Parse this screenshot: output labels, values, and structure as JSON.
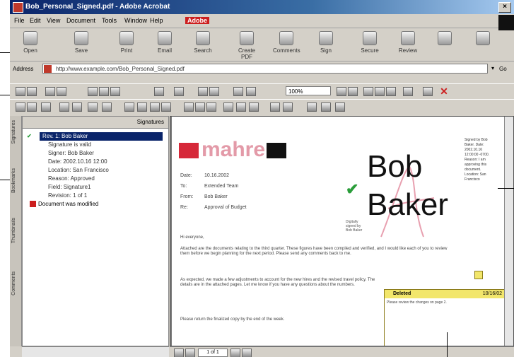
{
  "window": {
    "title": "Bob_Personal_Signed.pdf - Adobe Acrobat"
  },
  "menu": [
    "File",
    "Edit",
    "View",
    "Document",
    "Tools",
    "Window",
    "Help"
  ],
  "menu_badge": "Adobe",
  "toolbar": [
    "Open",
    "Save",
    "Print",
    "Email",
    "Search",
    "Create PDF",
    "Comments",
    "Sign",
    "Secure",
    "Review"
  ],
  "address": {
    "label": "Address",
    "value": "http://www.example.com/Bob_Personal_Signed.pdf",
    "go_label": "Go"
  },
  "zoom": "100%",
  "nav_tabs": [
    "Signatures",
    "Bookmarks",
    "Thumbnails",
    "Comments"
  ],
  "signatures_panel": {
    "header": "Signatures",
    "selected": "Rev. 1: Bob Baker",
    "children": [
      "Signature is valid",
      "Signer: Bob Baker",
      "Date: 2002.10.16 12:00",
      "Location: San Francisco",
      "Reason: Approved",
      "Field: Signature1",
      "Revision: 1 of 1"
    ],
    "warning": "Document was modified"
  },
  "document": {
    "logo_text": "mahre",
    "memo": [
      {
        "k": "Date:",
        "v": "10.16.2002"
      },
      {
        "k": "To:",
        "v": "Extended Team"
      },
      {
        "k": "From:",
        "v": "Bob Baker"
      },
      {
        "k": "Re:",
        "v": "Approval of Budget"
      }
    ],
    "signer_name_1": "Bob",
    "signer_name_2": "Baker",
    "sig_caption": "Digitally signed by Bob Baker",
    "side_text": "Signed by Bob Baker. Date: 2002.10.16 12:00:00 -0700. Reason: I am approving this document. Location: San Francisco",
    "greeting": "Hi everyone,",
    "para1": "Attached are the documents relating to the third quarter. These figures have been compiled and verified, and I would like each of you to review them before we begin planning for the next period. Please send any comments back to me.",
    "para2": "As expected, we made a few adjustments to account for the new hires and the revised travel policy. The details are in the attached pages. Let me know if you have any questions about the numbers.",
    "para3": "Please return the finalized copy by the end of the week.",
    "note": {
      "author": "Deleted",
      "date": "10/16/02",
      "text": "Please review the changes on page 2."
    }
  },
  "status": {
    "page": "1 of 1"
  }
}
